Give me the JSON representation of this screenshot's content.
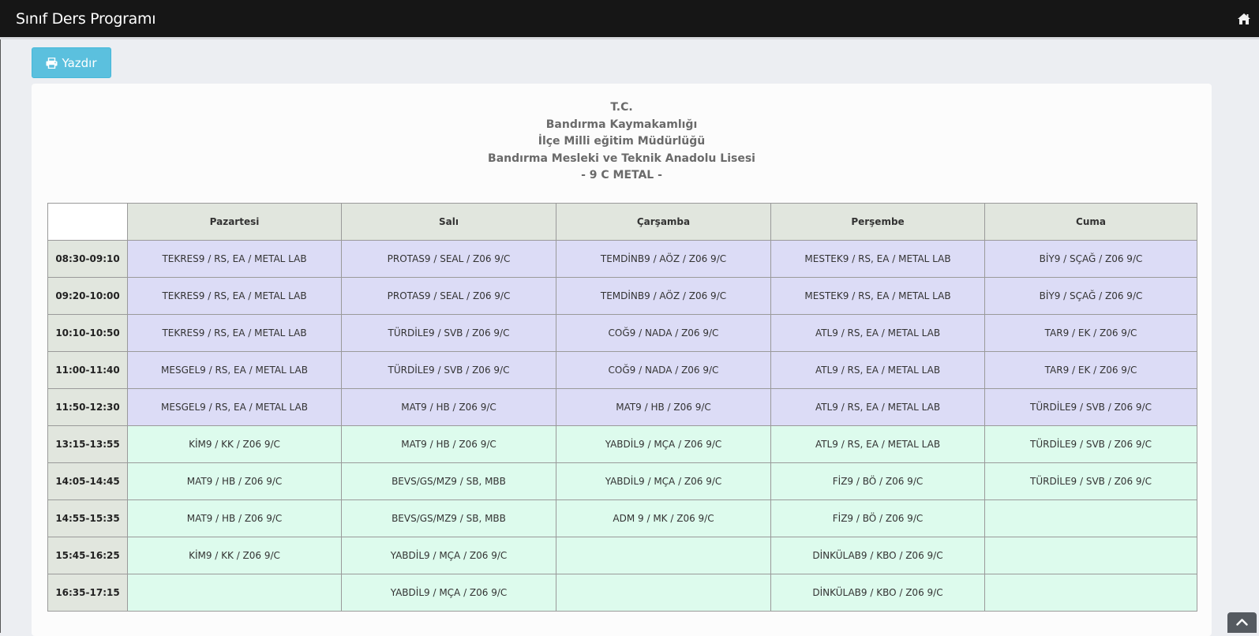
{
  "app": {
    "title": "Sınıf Ders Programı"
  },
  "toolbar": {
    "print_label": "Yazdır"
  },
  "heading": {
    "lines": [
      "T.C.",
      "Bandırma Kaymakamlığı",
      "İlçe Milli eğitim Müdürlüğü",
      "Bandırma Mesleki ve Teknik Anadolu Lisesi",
      "- 9 C METAL -"
    ]
  },
  "schedule": {
    "corner": "",
    "days": [
      "Pazartesi",
      "Salı",
      "Çarşamba",
      "Perşembe",
      "Cuma"
    ],
    "rows": [
      {
        "time": "08:30-09:10",
        "cells": [
          "TEKRES9 / RS, EA / METAL LAB",
          "PROTAS9 / SEAL / Z06 9/C",
          "TEMDİNB9 / AÖZ / Z06 9/C",
          "MESTEK9 / RS, EA / METAL LAB",
          "BİY9 / SÇAĞ / Z06 9/C"
        ]
      },
      {
        "time": "09:20-10:00",
        "cells": [
          "TEKRES9 / RS, EA / METAL LAB",
          "PROTAS9 / SEAL / Z06 9/C",
          "TEMDİNB9 / AÖZ / Z06 9/C",
          "MESTEK9 / RS, EA / METAL LAB",
          "BİY9 / SÇAĞ / Z06 9/C"
        ]
      },
      {
        "time": "10:10-10:50",
        "cells": [
          "TEKRES9 / RS, EA / METAL LAB",
          "TÜRDİLE9 / SVB / Z06 9/C",
          "COĞ9 / NADA / Z06 9/C",
          "ATL9 / RS, EA / METAL LAB",
          "TAR9 / EK / Z06 9/C"
        ]
      },
      {
        "time": "11:00-11:40",
        "cells": [
          "MESGEL9 / RS, EA / METAL LAB",
          "TÜRDİLE9 / SVB / Z06 9/C",
          "COĞ9 / NADA / Z06 9/C",
          "ATL9 / RS, EA / METAL LAB",
          "TAR9 / EK / Z06 9/C"
        ]
      },
      {
        "time": "11:50-12:30",
        "cells": [
          "MESGEL9 / RS, EA / METAL LAB",
          "MAT9 / HB / Z06 9/C",
          "MAT9 / HB / Z06 9/C",
          "ATL9 / RS, EA / METAL LAB",
          "TÜRDİLE9 / SVB / Z06 9/C"
        ]
      },
      {
        "time": "13:15-13:55",
        "cells": [
          "KİM9 / KK / Z06 9/C",
          "MAT9 / HB / Z06 9/C",
          "YABDİL9 / MÇA / Z06 9/C",
          "ATL9 / RS, EA / METAL LAB",
          "TÜRDİLE9 / SVB / Z06 9/C"
        ]
      },
      {
        "time": "14:05-14:45",
        "cells": [
          "MAT9 / HB / Z06 9/C",
          "BEVS/GS/MZ9 / SB, MBB",
          "YABDİL9 / MÇA / Z06 9/C",
          "FİZ9 / BÖ / Z06 9/C",
          "TÜRDİLE9 / SVB / Z06 9/C"
        ]
      },
      {
        "time": "14:55-15:35",
        "cells": [
          "MAT9 / HB / Z06 9/C",
          "BEVS/GS/MZ9 / SB, MBB",
          "ADM 9 / MK / Z06 9/C",
          "FİZ9 / BÖ / Z06 9/C",
          ""
        ]
      },
      {
        "time": "15:45-16:25",
        "cells": [
          "KİM9 / KK / Z06 9/C",
          "YABDİL9 / MÇA / Z06 9/C",
          "",
          "DİNKÜLAB9 / KBO / Z06 9/C",
          ""
        ]
      },
      {
        "time": "16:35-17:15",
        "cells": [
          "",
          "YABDİL9 / MÇA / Z06 9/C",
          "",
          "DİNKÜLAB9 / KBO / Z06 9/C",
          ""
        ]
      }
    ]
  },
  "colors": {
    "topbar": "#161616",
    "print_button": "#5bc0de",
    "header_cell": "#e1e6de",
    "morning_cell": "#dcdcf6",
    "afternoon_cell": "#ddfbed"
  },
  "icons": {
    "home": "home-icon",
    "print": "print-icon",
    "scroll_top": "chevron-up-icon"
  }
}
